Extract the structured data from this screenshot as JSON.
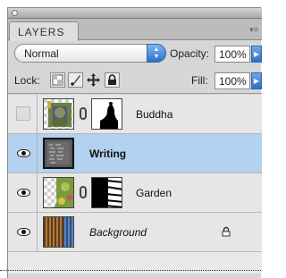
{
  "panel": {
    "tab_label": "LAYERS",
    "menu_glyph": "▾≡"
  },
  "blend_mode": {
    "value": "Normal"
  },
  "opacity": {
    "label": "Opacity:",
    "value": "100%"
  },
  "lock": {
    "label": "Lock:"
  },
  "fill": {
    "label": "Fill:",
    "value": "100%"
  },
  "layers": [
    {
      "name": "Buddha",
      "visible": false,
      "selected": false,
      "has_mask": true
    },
    {
      "name": "Writing",
      "visible": true,
      "selected": true,
      "has_mask": false
    },
    {
      "name": "Garden",
      "visible": true,
      "selected": false,
      "has_mask": true
    },
    {
      "name": "Background",
      "visible": true,
      "selected": false,
      "has_mask": false,
      "locked": true
    }
  ],
  "colors": {
    "selected_row": "#b3d1f0",
    "accent_blue": "#2f71c8"
  }
}
